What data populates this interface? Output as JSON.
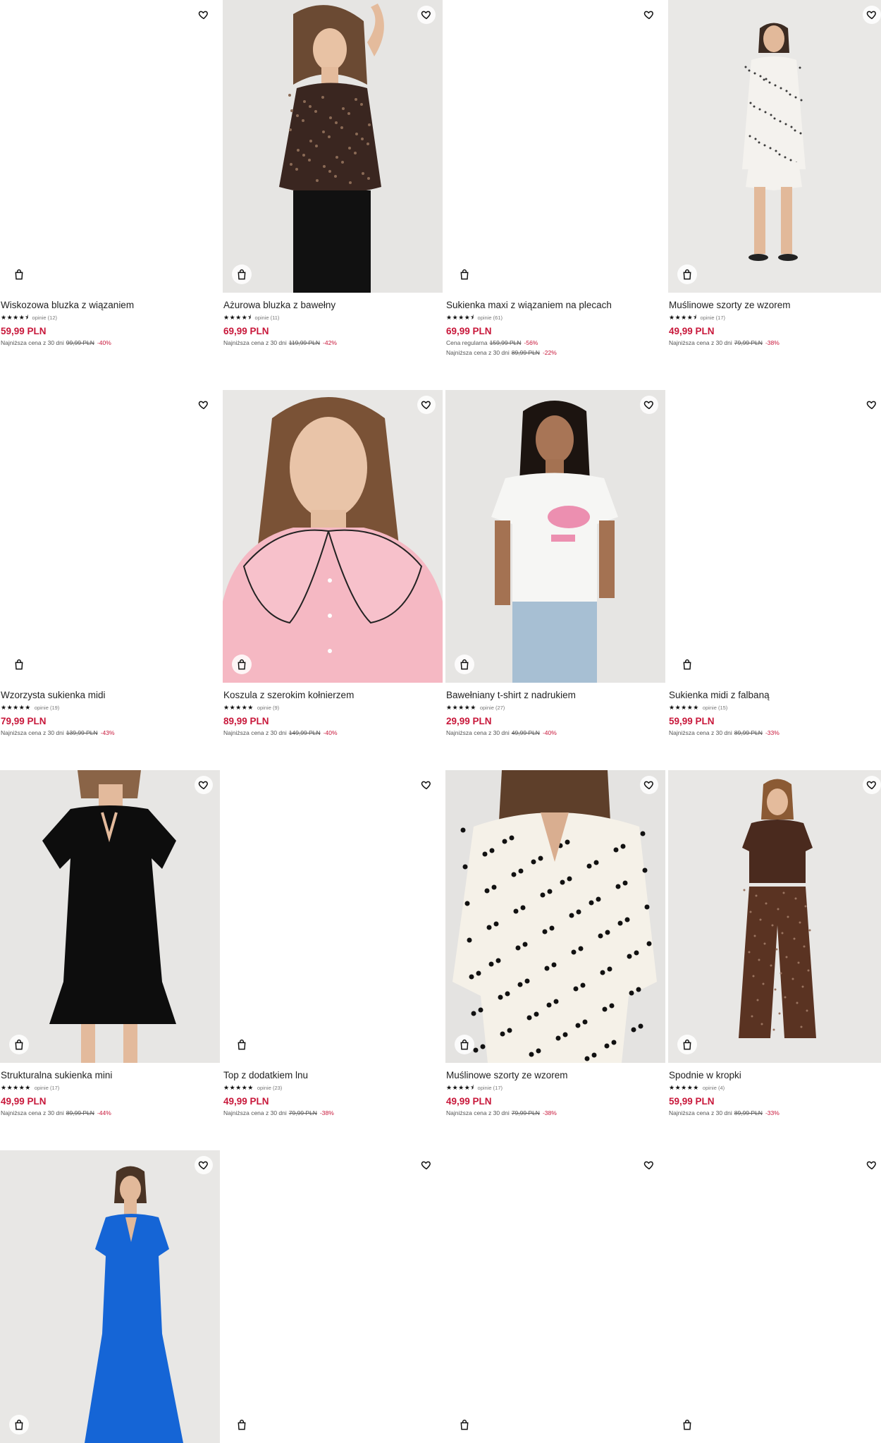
{
  "products": [
    {
      "name": "Wiskozowa bluzka z wiązaniem",
      "stars": "★★★★⯨",
      "reviews": "opinie (12)",
      "price": "59,99 PLN",
      "lowest": [
        {
          "label": "Najniższa cena z 30 dni",
          "old": "99,99 PLN",
          "discount": "-40%"
        }
      ],
      "image": "blank"
    },
    {
      "name": "Ażurowa bluzka z bawełny",
      "stars": "★★★★⯨",
      "reviews": "opinie (11)",
      "price": "69,99 PLN",
      "lowest": [
        {
          "label": "Najniższa cena z 30 dni",
          "old": "119,99 PLN",
          "discount": "-42%"
        }
      ],
      "image": "photo-brown-top"
    },
    {
      "name": "Sukienka maxi z wiązaniem na plecach",
      "stars": "★★★★⯨",
      "reviews": "opinie (61)",
      "price": "69,99 PLN",
      "lowest": [
        {
          "label": "Cena regularna",
          "old": "159,99 PLN",
          "discount": "-56%"
        },
        {
          "label": "Najniższa cena z 30 dni",
          "old": "89,99 PLN",
          "discount": "-22%"
        }
      ],
      "image": "blank"
    },
    {
      "name": "Muślinowe szorty ze wzorem",
      "stars": "★★★★⯨",
      "reviews": "opinie (17)",
      "price": "49,99 PLN",
      "lowest": [
        {
          "label": "Najniższa cena z 30 dni",
          "old": "79,99 PLN",
          "discount": "-38%"
        }
      ],
      "image": "photo-white-set"
    },
    {
      "name": "Wzorzysta sukienka midi",
      "stars": "★★★★★",
      "reviews": "opinie (19)",
      "price": "79,99 PLN",
      "lowest": [
        {
          "label": "Najniższa cena z 30 dni",
          "old": "139,99 PLN",
          "discount": "-43%"
        }
      ],
      "image": "blank"
    },
    {
      "name": "Koszula z szerokim kołnierzem",
      "stars": "★★★★★",
      "reviews": "opinie (9)",
      "price": "89,99 PLN",
      "lowest": [
        {
          "label": "Najniższa cena z 30 dni",
          "old": "149,99 PLN",
          "discount": "-40%"
        }
      ],
      "image": "photo-pink-shirt"
    },
    {
      "name": "Bawełniany t-shirt z nadrukiem",
      "stars": "★★★★★",
      "reviews": "opinie (27)",
      "price": "29,99 PLN",
      "lowest": [
        {
          "label": "Najniższa cena z 30 dni",
          "old": "49,99 PLN",
          "discount": "-40%"
        }
      ],
      "image": "photo-tshirt"
    },
    {
      "name": "Sukienka midi z falbaną",
      "stars": "★★★★★",
      "reviews": "opinie (15)",
      "price": "59,99 PLN",
      "lowest": [
        {
          "label": "Najniższa cena z 30 dni",
          "old": "89,99 PLN",
          "discount": "-33%"
        }
      ],
      "image": "blank"
    },
    {
      "name": "Strukturalna sukienka mini",
      "stars": "★★★★★",
      "reviews": "opinie (17)",
      "price": "49,99 PLN",
      "lowest": [
        {
          "label": "Najniższa cena z 30 dni",
          "old": "89,99 PLN",
          "discount": "-44%"
        }
      ],
      "image": "photo-black-dress"
    },
    {
      "name": "Top z dodatkiem lnu",
      "stars": "★★★★★",
      "reviews": "opinie (23)",
      "price": "49,99 PLN",
      "lowest": [
        {
          "label": "Najniższa cena z 30 dni",
          "old": "79,99 PLN",
          "discount": "-38%"
        }
      ],
      "image": "blank"
    },
    {
      "name": "Muślinowe szorty ze wzorem",
      "stars": "★★★★⯨",
      "reviews": "opinie (17)",
      "price": "49,99 PLN",
      "lowest": [
        {
          "label": "Najniższa cena z 30 dni",
          "old": "79,99 PLN",
          "discount": "-38%"
        }
      ],
      "image": "photo-polka-set"
    },
    {
      "name": "Spodnie w kropki",
      "stars": "★★★★★",
      "reviews": "opinie (4)",
      "price": "59,99 PLN",
      "lowest": [
        {
          "label": "Najniższa cena z 30 dni",
          "old": "89,99 PLN",
          "discount": "-33%"
        }
      ],
      "image": "photo-brown-pants"
    },
    {
      "name": "",
      "stars": "",
      "reviews": "",
      "price": "",
      "lowest": [],
      "image": "photo-blue-dress"
    },
    {
      "name": "",
      "stars": "",
      "reviews": "",
      "price": "",
      "lowest": [],
      "image": "blank"
    },
    {
      "name": "",
      "stars": "",
      "reviews": "",
      "price": "",
      "lowest": [],
      "image": "blank"
    },
    {
      "name": "",
      "stars": "",
      "reviews": "",
      "price": "",
      "lowest": [],
      "image": "blank"
    }
  ],
  "icons": {
    "favorite": "heart-icon",
    "add_to_cart": "shopping-bag-icon"
  },
  "colors": {
    "price": "#c8173a",
    "discount": "#c8173a",
    "text": "#222222",
    "muted": "#777777"
  }
}
